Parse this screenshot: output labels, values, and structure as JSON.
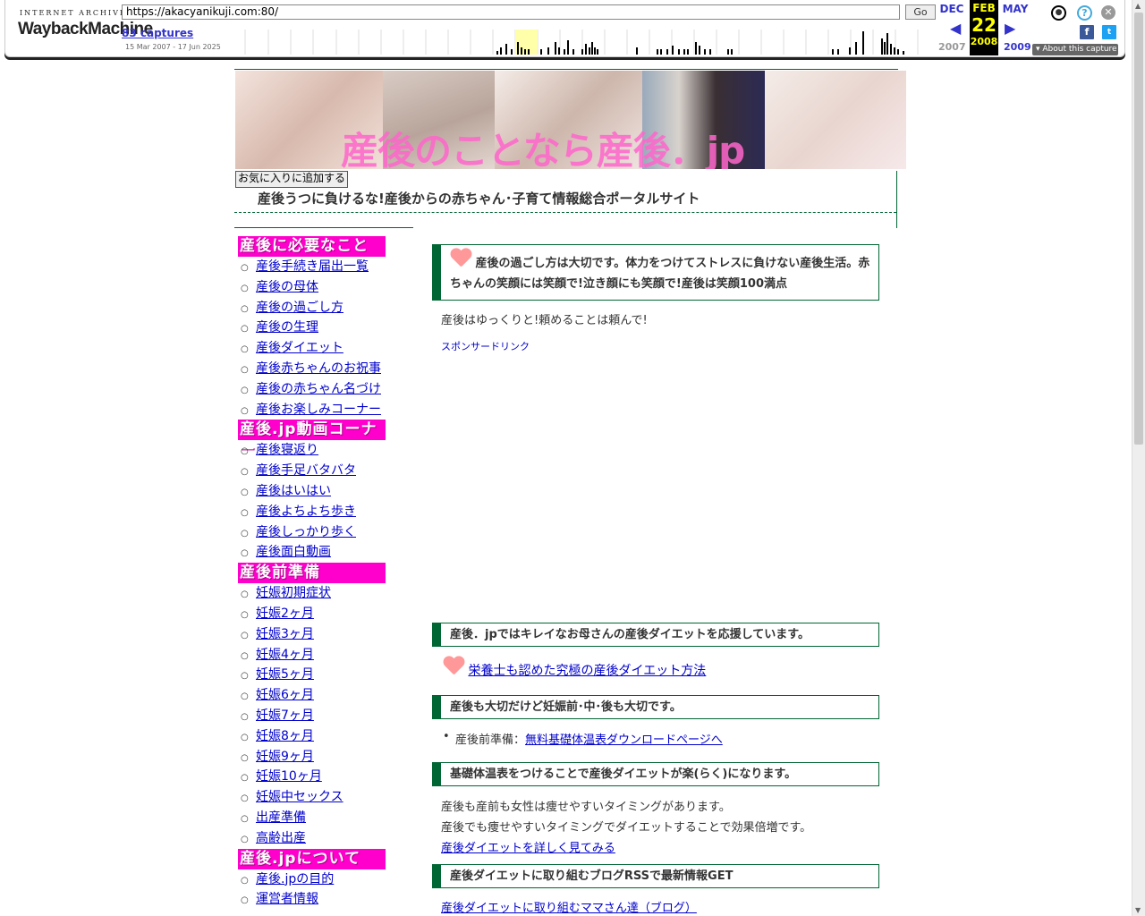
{
  "wayback": {
    "logo_top": "INTERNET ARCHIVE",
    "logo_main": "WaybackMachine",
    "url": "https://akacyanikuji.com:80/",
    "go_label": "Go",
    "captures": "83 captures",
    "date_range": "15 Mar 2007 - 17 Jun 2025",
    "prev_month": "DEC",
    "cur_month": "FEB",
    "cur_day": "22",
    "cur_year": "2008",
    "next_month": "MAY",
    "prev_year": "2007",
    "next_year": "2009",
    "about": "About this capture"
  },
  "header": {
    "banner_text": "産後のことなら産後．jp",
    "fav_button": "お気に入りに追加する",
    "tagline": "産後うつに負けるな!産後からの赤ちゃん･子育て情報総合ポータルサイト"
  },
  "sidebar": {
    "sections": [
      {
        "title": "産後に必要なこと",
        "items": [
          "産後手続き届出一覧",
          "産後の母体",
          "産後の過ごし方",
          "産後の生理",
          "産後ダイエット",
          "産後赤ちゃんのお祝事",
          "産後の赤ちゃん名づけ",
          "産後お楽しみコーナー"
        ]
      },
      {
        "title": "産後.jp動画コーナー",
        "items": [
          "産後寝返り",
          "産後手足バタバタ",
          "産後はいはい",
          "産後よちよち歩き",
          "産後しっかり歩く",
          "産後面白動画"
        ]
      },
      {
        "title": "産後前準備",
        "items": [
          "妊娠初期症状",
          "妊娠2ヶ月",
          "妊娠3ヶ月",
          "妊娠4ヶ月",
          "妊娠5ヶ月",
          "妊娠6ヶ月",
          "妊娠7ヶ月",
          "妊娠8ヶ月",
          "妊娠9ヶ月",
          "妊娠10ヶ月",
          "妊娠中セックス",
          "出産準備",
          "高齢出産"
        ]
      },
      {
        "title": "産後.jpについて",
        "items": [
          "産後.jpの目的",
          "運営者情報"
        ]
      }
    ]
  },
  "main": {
    "box1": "産後の過ごし方は大切です。体力をつけてストレスに負けない産後生活。赤ちゃんの笑顔には笑顔で!泣き顔にも笑顔で!産後は笑顔100満点",
    "intro": "産後はゆっくりと!頼めることは頼んで!",
    "sponsor": "スポンサードリンク",
    "box2": "産後．jpではキレイなお母さんの産後ダイエットを応援しています。",
    "diet_link": "栄養士も認めた究極の産後ダイエット方法",
    "box3": "産後も大切だけど妊娠前･中･後も大切です。",
    "prep_label": "産後前準備：",
    "prep_link": "無料基礎体温表ダウンロードページへ",
    "box4": "基礎体温表をつけることで産後ダイエットが楽(らく)になります。",
    "p1": "産後も産前も女性は痩せやすいタイミングがあります。",
    "p2": "産後でも痩せやすいタイミングでダイエットすることで効果倍増です。",
    "more_link": "産後ダイエットを詳しく見てみる",
    "box5": "産後ダイエットに取り組むブログRSSで最新情報GET",
    "blog_link": "産後ダイエットに取り組むママさん達（ブログ）"
  }
}
